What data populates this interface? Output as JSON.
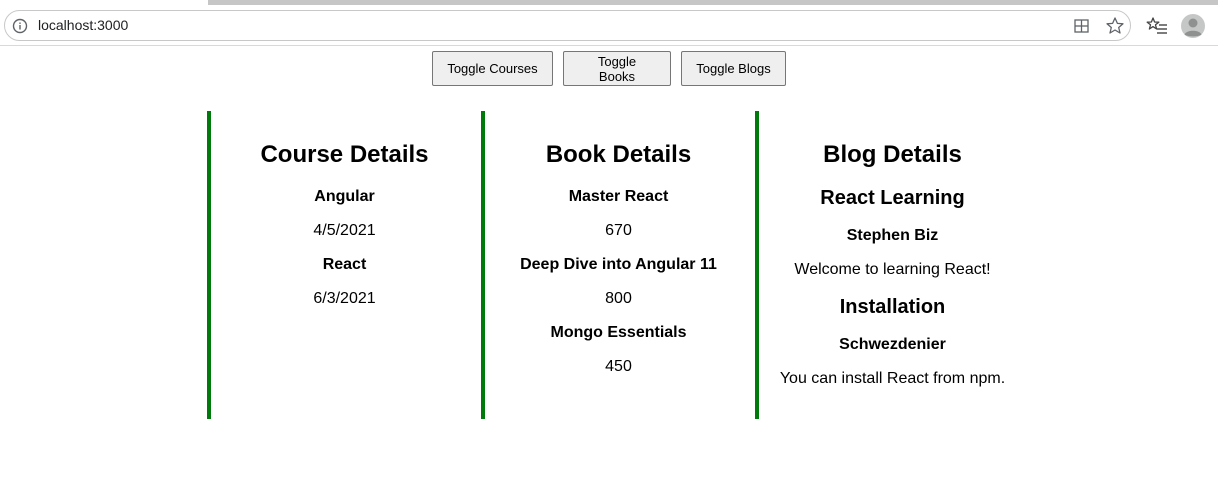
{
  "browser": {
    "url": "localhost:3000"
  },
  "toggles": {
    "courses": "Toggle Courses",
    "books": "Toggle Books",
    "blogs": "Toggle Blogs"
  },
  "courses": {
    "heading": "Course Details",
    "items": [
      {
        "name": "Angular",
        "date": "4/5/2021"
      },
      {
        "name": "React",
        "date": "6/3/2021"
      }
    ]
  },
  "books": {
    "heading": "Book Details",
    "items": [
      {
        "name": "Master React",
        "price": "670"
      },
      {
        "name": "Deep Dive into Angular 11",
        "price": "800"
      },
      {
        "name": "Mongo Essentials",
        "price": "450"
      }
    ]
  },
  "blogs": {
    "heading": "Blog Details",
    "items": [
      {
        "title": "React Learning",
        "author": "Stephen Biz",
        "content": "Welcome to learning React!"
      },
      {
        "title": "Installation",
        "author": "Schwezdenier",
        "content": "You can install React from npm."
      }
    ]
  },
  "colors": {
    "border_accent": "#007a0a"
  }
}
